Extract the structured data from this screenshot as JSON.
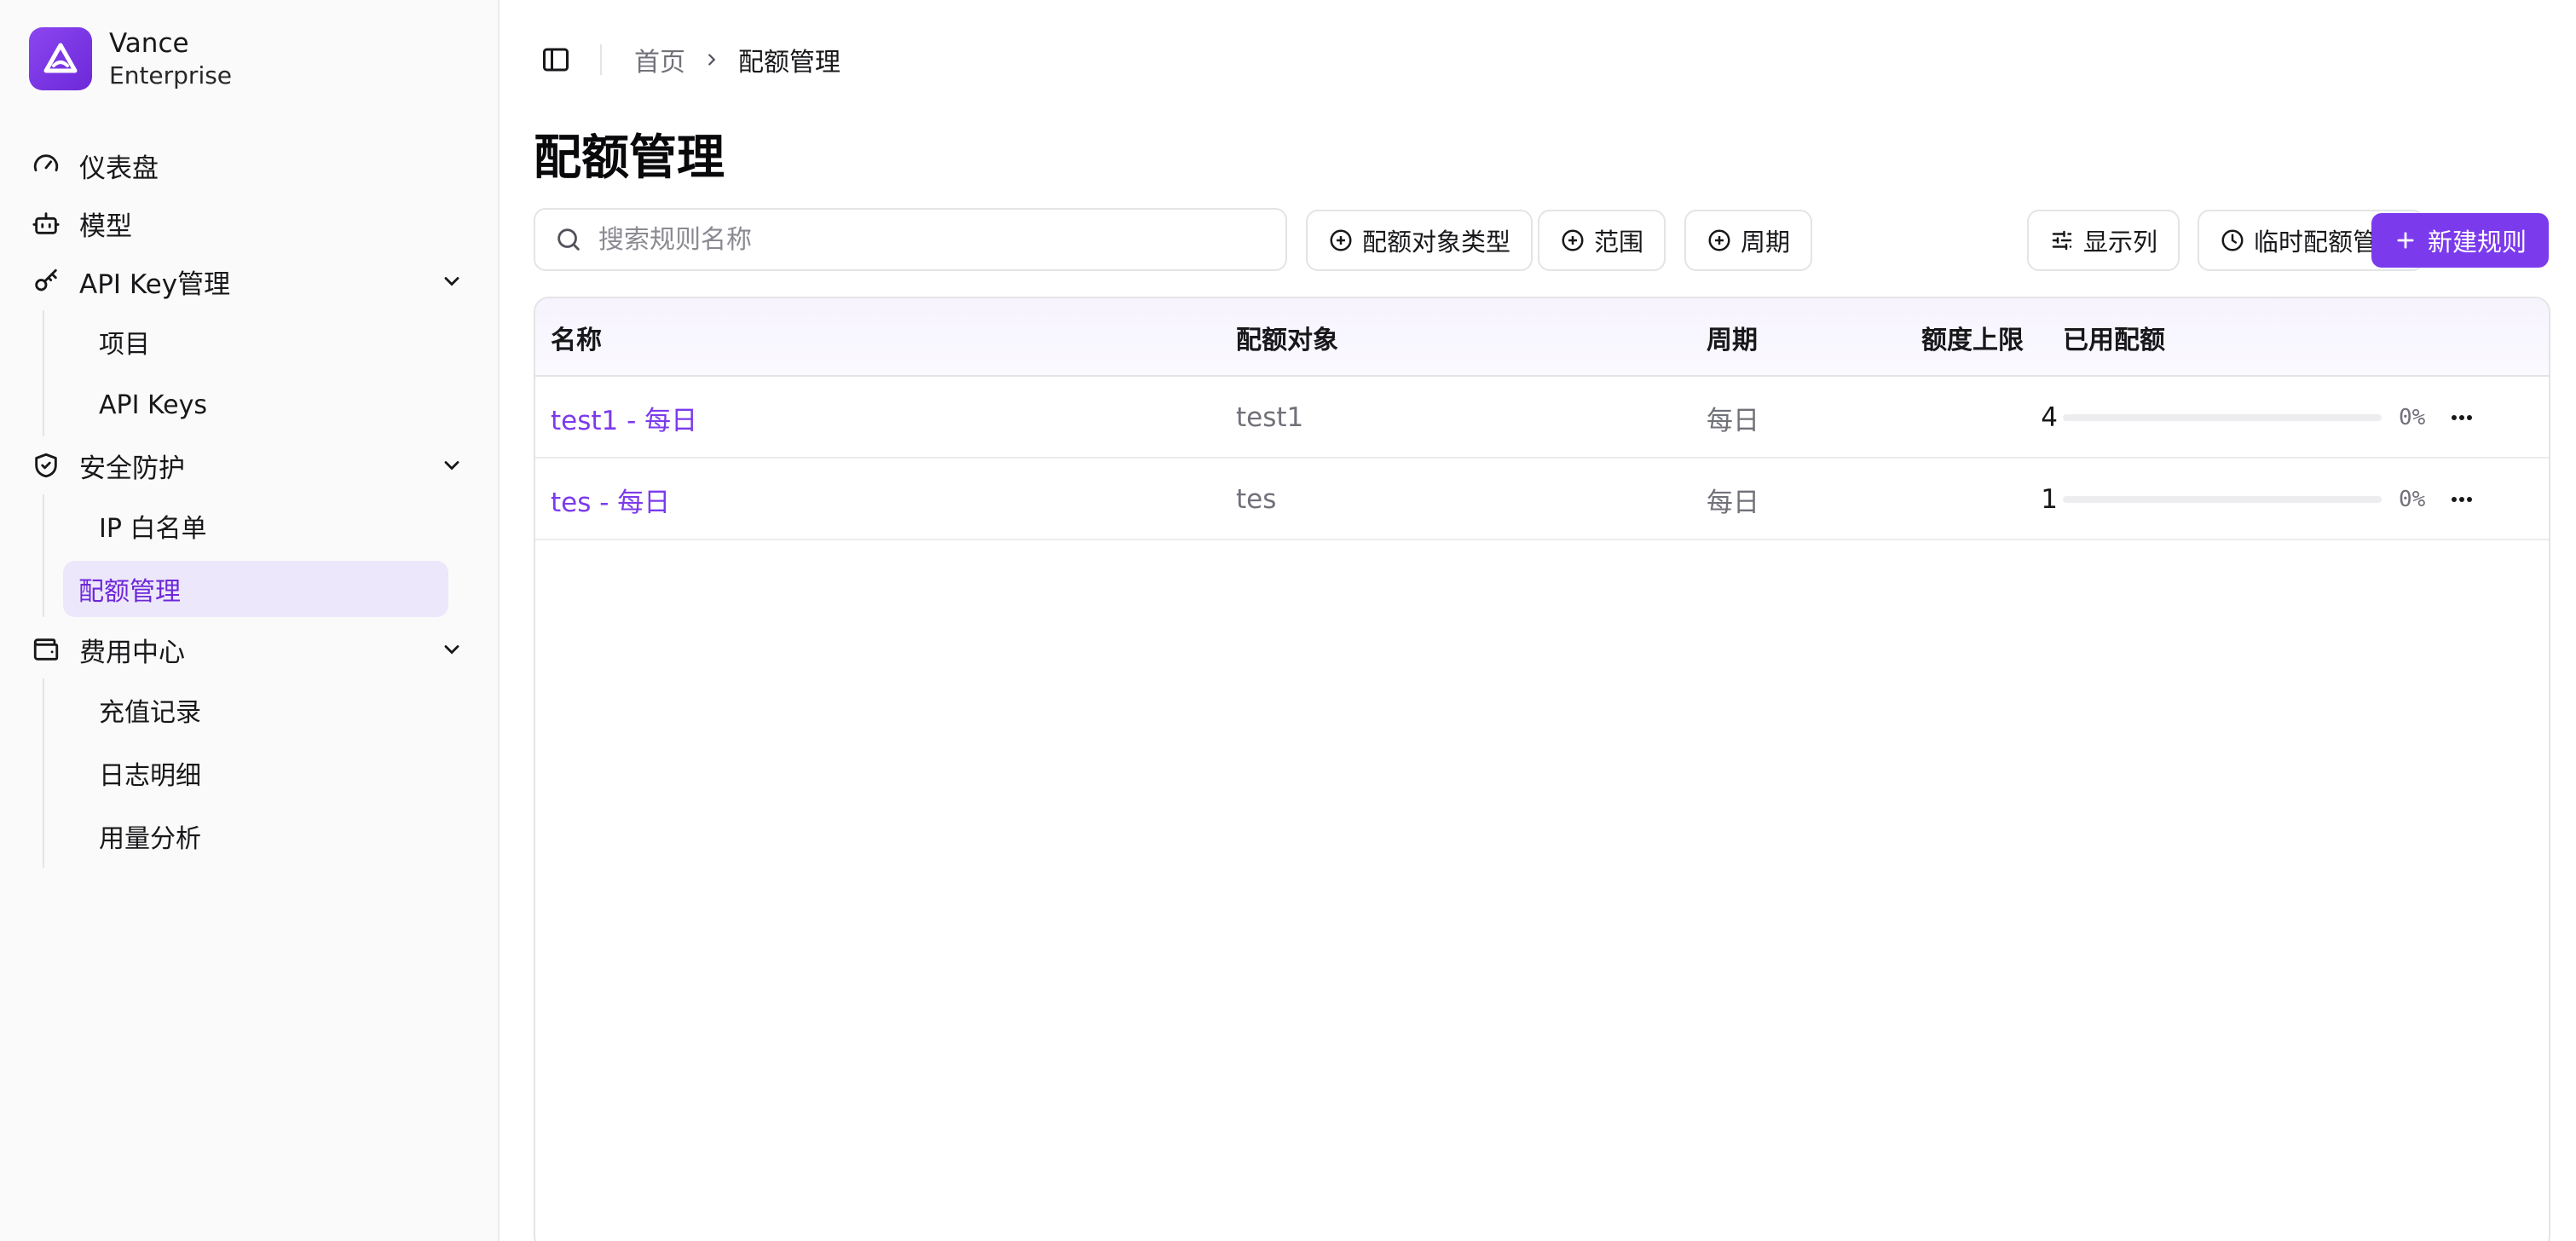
{
  "brand": {
    "name": "Vance",
    "subtitle": "Enterprise",
    "accent": "#7c3aed"
  },
  "sidebar": {
    "items": [
      {
        "label": "仪表盘",
        "icon": "gauge-icon"
      },
      {
        "label": "模型",
        "icon": "bot-icon"
      },
      {
        "label": "API Key管理",
        "icon": "key-icon",
        "expanded": true,
        "children": [
          {
            "label": "项目"
          },
          {
            "label": "API Keys"
          }
        ]
      },
      {
        "label": "安全防护",
        "icon": "shield-icon",
        "expanded": true,
        "children": [
          {
            "label": "IP 白名单"
          },
          {
            "label": "配额管理",
            "active": true
          }
        ]
      },
      {
        "label": "费用中心",
        "icon": "wallet-icon",
        "expanded": true,
        "children": [
          {
            "label": "充值记录"
          },
          {
            "label": "日志明细"
          },
          {
            "label": "用量分析"
          }
        ]
      }
    ]
  },
  "breadcrumb": {
    "home": "首页",
    "current": "配额管理"
  },
  "page": {
    "title": "配额管理"
  },
  "toolbar": {
    "search_placeholder": "搜索规则名称",
    "filters": {
      "target_type": "配额对象类型",
      "scope": "范围",
      "period": "周期"
    },
    "columns_label": "显示列",
    "temp_quota_label": "临时配额管理",
    "new_rule_label": "新建规则"
  },
  "table": {
    "headers": {
      "name": "名称",
      "target": "配额对象",
      "period": "周期",
      "limit": "额度上限",
      "used": "已用配额"
    },
    "rows": [
      {
        "name": "test1 - 每日",
        "target": "test1",
        "period": "每日",
        "limit": "4",
        "used_pct": "0%",
        "used_fraction": 0
      },
      {
        "name": "tes - 每日",
        "target": "tes",
        "period": "每日",
        "limit": "1",
        "used_pct": "0%",
        "used_fraction": 0
      }
    ]
  }
}
